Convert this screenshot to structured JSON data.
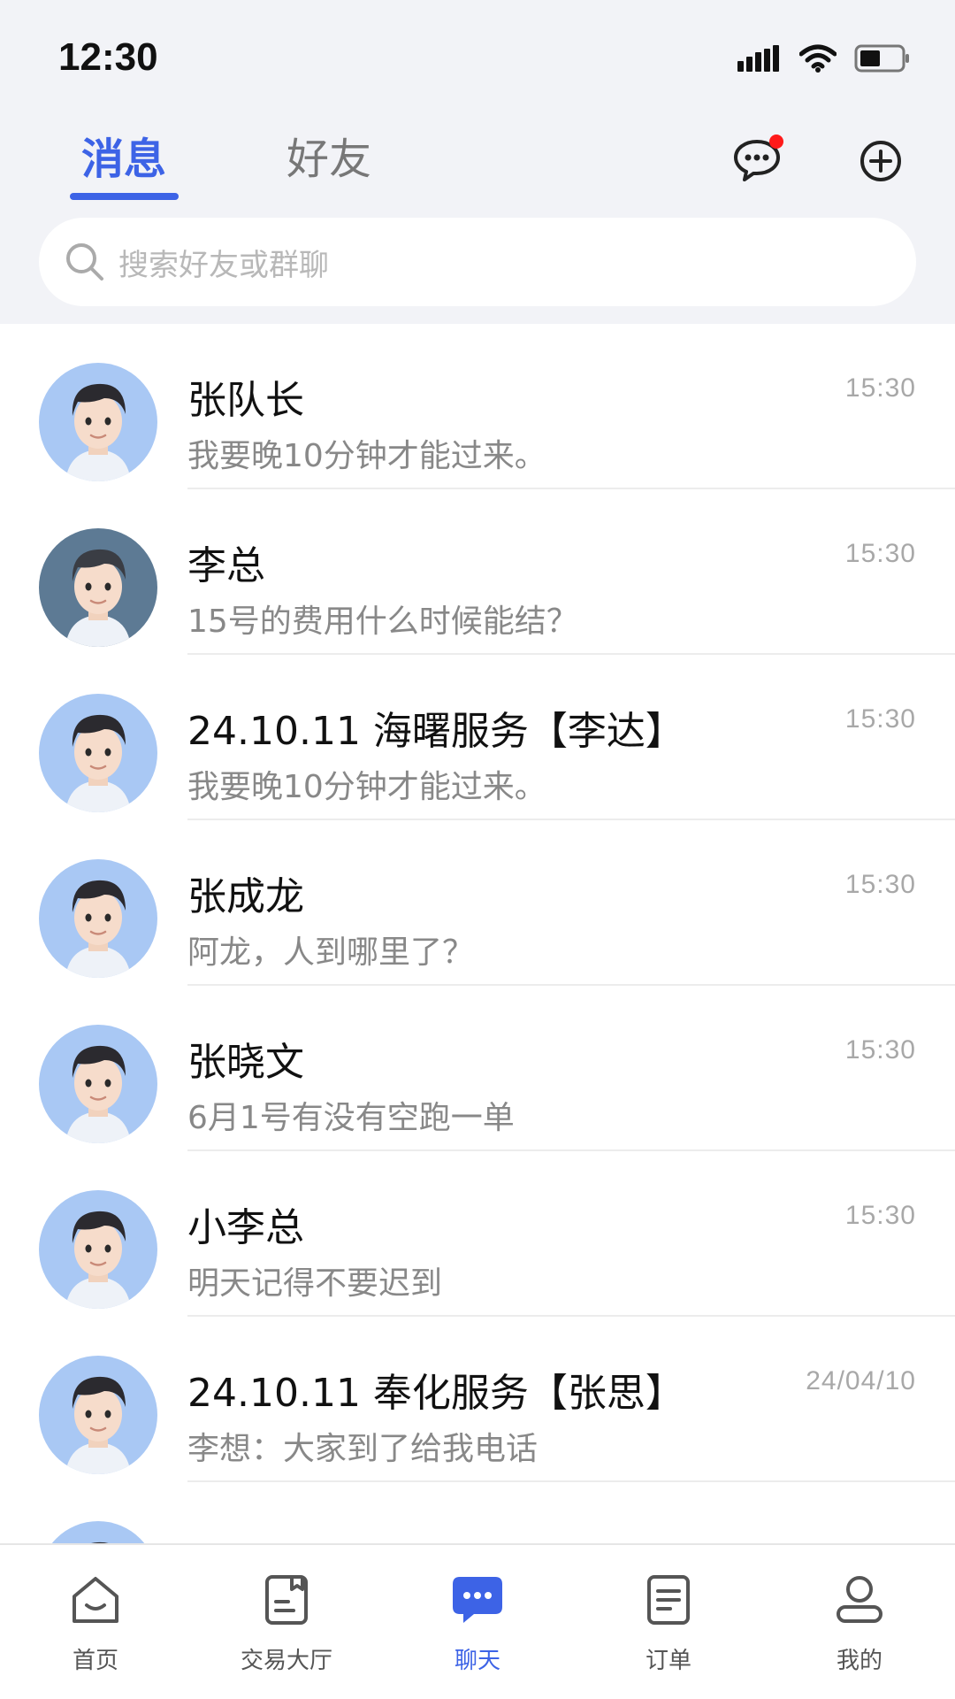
{
  "status_bar": {
    "time": "12:30"
  },
  "tabs": {
    "messages": "消息",
    "friends": "好友"
  },
  "search": {
    "placeholder": "搜索好友或群聊"
  },
  "chats": [
    {
      "name": "张队长",
      "preview": "我要晚10分钟才能过来。",
      "time": "15:30"
    },
    {
      "name": "李总",
      "preview": "15号的费用什么时候能结？",
      "time": "15:30"
    },
    {
      "name": "24.10.11 海曙服务【李达】",
      "preview": "我要晚10分钟才能过来。",
      "time": "15:30"
    },
    {
      "name": "张成龙",
      "preview": "阿龙，人到哪里了？",
      "time": "15:30"
    },
    {
      "name": "张晓文",
      "preview": "6月1号有没有空跑一单",
      "time": "15:30"
    },
    {
      "name": "小李总",
      "preview": "明天记得不要迟到",
      "time": "15:30"
    },
    {
      "name": "24.10.11 奉化服务【张思】",
      "preview": "李想：大家到了给我电话",
      "time": "24/04/10"
    }
  ],
  "bottom_nav": {
    "home": "首页",
    "hall": "交易大厅",
    "chat": "聊天",
    "orders": "订单",
    "mine": "我的"
  },
  "colors": {
    "accent": "#3d63e6",
    "badge": "#ff1a1a",
    "header_bg": "#f2f3f7"
  }
}
